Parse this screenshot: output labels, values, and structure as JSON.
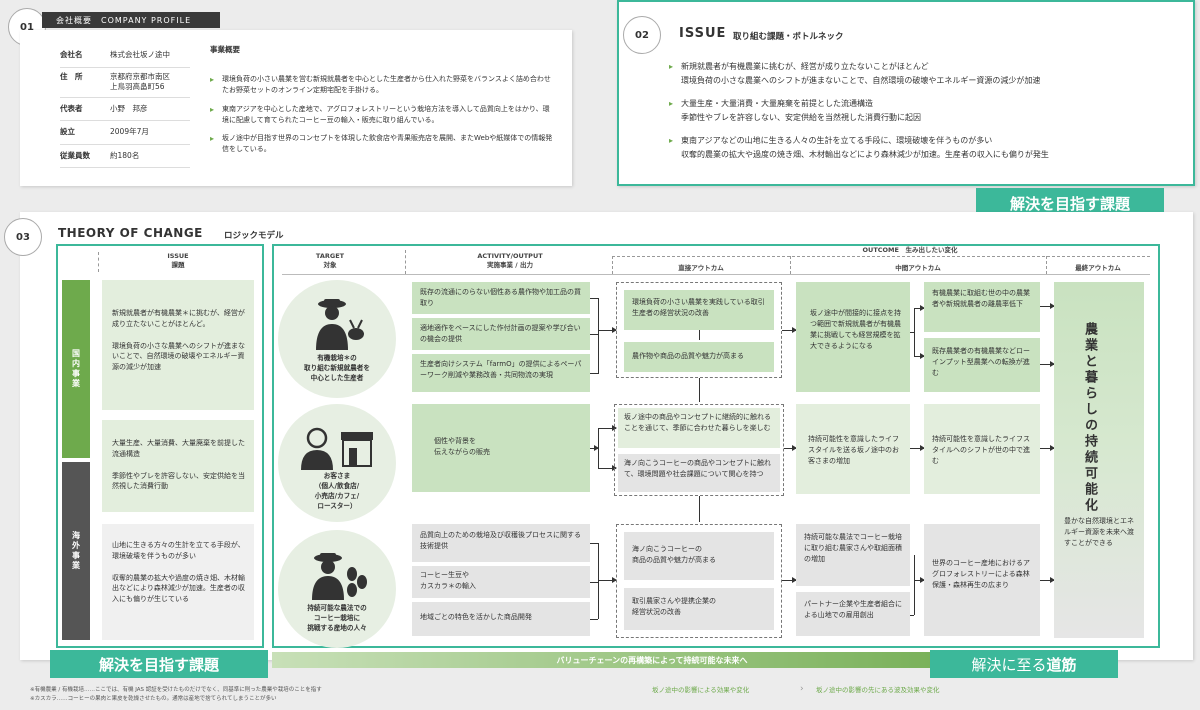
{
  "section1": {
    "num": "01",
    "heading": "会社概要　COMPANY PROFILE",
    "rows": [
      {
        "label": "会社名",
        "value": "株式会社坂ノ途中"
      },
      {
        "label": "住　所",
        "value": "京都府京都市南区\n上鳥羽高畠町56"
      },
      {
        "label": "代表者",
        "value": "小野　邦彦"
      },
      {
        "label": "設立",
        "value": "2009年7月"
      },
      {
        "label": "従業員数",
        "value": "約180名"
      }
    ],
    "business_title": "事業概要",
    "business": [
      "環境負荷の小さい農業を営む新規就農者を中心とした生産者から仕入れた野菜をバランスよく詰め合わせたお野菜セットのオンライン定期宅配を手掛ける。",
      "東南アジアを中心とした産地で、アグロフォレストリーという栽培方法を導入して品質向上をはかり、環境に配慮して育てられたコーヒー豆の輸入・販売に取り組んでいる。",
      "坂ノ途中が目指す世界のコンセプトを体現した飲食店や青果販売店を展開、またWebや紙媒体での情報発信をしている。"
    ]
  },
  "section2": {
    "num": "02",
    "title_en": "ISSUE",
    "title_jp": "取り組む課題・ボトルネック",
    "items": [
      {
        "head": "新規就農者が有機農業に挑むが、経営が成り立たないことがほとんど",
        "sub": "環境負荷の小さな農業へのシフトが進まないことで、自然環境の破壊やエネルギー資源の減少が加速"
      },
      {
        "head": "大量生産・大量消費・大量廃棄を前提とした流通構造",
        "sub": "季節性やブレを許容しない、安定供給を当然視した消費行動に起因"
      },
      {
        "head": "東南アジアなどの山地に生きる人々の生計を立てる手段に、環境破壊を伴うものが多い",
        "sub": "収奪的農業の拡大や過度の焼き畑、木材輸出などにより森林減少が加速。生産者の収入にも偏りが発生"
      }
    ],
    "badge": "解決を目指す課題"
  },
  "section3": {
    "num": "03",
    "title_en": "THEORY OF CHANGE",
    "title_jp": "ロジックモデル",
    "issue_header": "ISSUE\n課題",
    "side_domestic": "国内事業",
    "side_overseas": "海外事業",
    "issues": [
      "新規就農者が有機農業＊に挑むが、経営が成り立たないことがほとんど。\n\n環境負荷の小さな農業へのシフトが進まないことで、自然環境の破壊やエネルギー資源の減少が加速",
      "大量生産、大量消費、大量廃棄を前提した流通構造\n\n季節性やブレを許容しない、安定供給を当然視した消費行動",
      "山地に生きる方々の生計を立てる手段が、環境破壊を伴うものが多い\n\n収奪的農業の拡大や過度の焼き畑、木材輸出などにより森林減少が加速。生産者の収入にも偏りが生じている"
    ],
    "target_header": "TARGET\n対象",
    "activity_header": "ACTIVITY/OUTPUT\n実施事業 / 出力",
    "outcome_header": "OUTCOME　生み出したい変化",
    "direct_header": "直接アウトカム",
    "mid_header": "中間アウトカム",
    "final_header": "最終アウトカム",
    "targets": [
      "有機栽培＊の\n取り組む新規就農者を\n中心とした生産者",
      "お客さま\n（個人/飲食店/\n小売店/カフェ/\nロースター）",
      "持続可能な農法での\nコーヒー栽培に\n挑戦する産地の人々"
    ],
    "activities": [
      "既存の流通にのらない個性ある農作物や加工品の買取り",
      "適地適作をベースにした作付計画の提案や学び合いの機会の提供",
      "生産者向けシステム「farmO」の提供によるペーパーワーク削減や業務改善・共同物流の実現",
      "個性や背景を\n伝えながらの販売",
      "品質向上のための栽培及び収穫後プロセスに関する技術提供",
      "コーヒー生豆や\nカスカラ＊の輸入",
      "地域ごとの特色を活かした商品開発"
    ],
    "direct": [
      "環境負荷の小さい農業を実践している取引生産者の経営状況の改善",
      "農作物や商品の品質や魅力が高まる",
      "坂ノ途中の商品やコンセプトに継続的に触れることを通じて、季節に合わせた暮らしを楽しむ",
      "海ノ向こうコーヒーの商品やコンセプトに触れて、環境問題や社会課題について関心を持つ",
      "海ノ向こうコーヒーの\n商品の品質や魅力が高まる",
      "取引農家さんや提携企業の\n経営状況の改善"
    ],
    "mid1": [
      "坂ノ途中が間接的に接点を持つ範囲で新規就農者が有機農業に挑戦しても経営規模を拡大できるようになる",
      "持続可能性を意識したライフスタイルを送る坂ノ途中のお客さまの増加",
      "持続可能な農法でコーヒー栽培に取り組む農家さんや取組面積の増加",
      "パートナー企業や生産者組合による山地での雇用創出"
    ],
    "mid2": [
      "有機農業に取組む世の中の農業者や新規就農者の離農率低下",
      "既存農業者の有機農業などローインプット型農業への転換が進む",
      "持続可能性を意識したライフスタイルへのシフトが世の中で進む",
      "世界のコーヒー産地におけるアグロフォレストリーによる森林保護・森林再生の広まり"
    ],
    "final_title": "農業と暮らしの持続可能化",
    "final_desc": "豊かな自然環境とエネルギー資源を未来へ渡すことができる",
    "bottom_bar": "バリューチェーンの再構築によって持続可能な未来へ",
    "badge_left": "解決を目指す課題",
    "badge_right_a": "解決に至る",
    "badge_right_b": "道筋",
    "legend_a": "坂ノ途中の影響による効果や変化",
    "legend_b": "坂ノ途中の影響の先にある波及効果や変化"
  },
  "footnotes": [
    "※有機農業 / 有機栽培……ここでは、有機 JAS 認証を受けたものだけでなく、同基準に則った農業や栽培のことを指す",
    "※カスカラ……コーヒーの果肉と果皮を乾燥させたもの。通常は産地で捨てられてしまうことが多い"
  ],
  "colors": {
    "accent": "#6eaa4c",
    "teal": "#3cb89a",
    "dark": "#555555"
  }
}
